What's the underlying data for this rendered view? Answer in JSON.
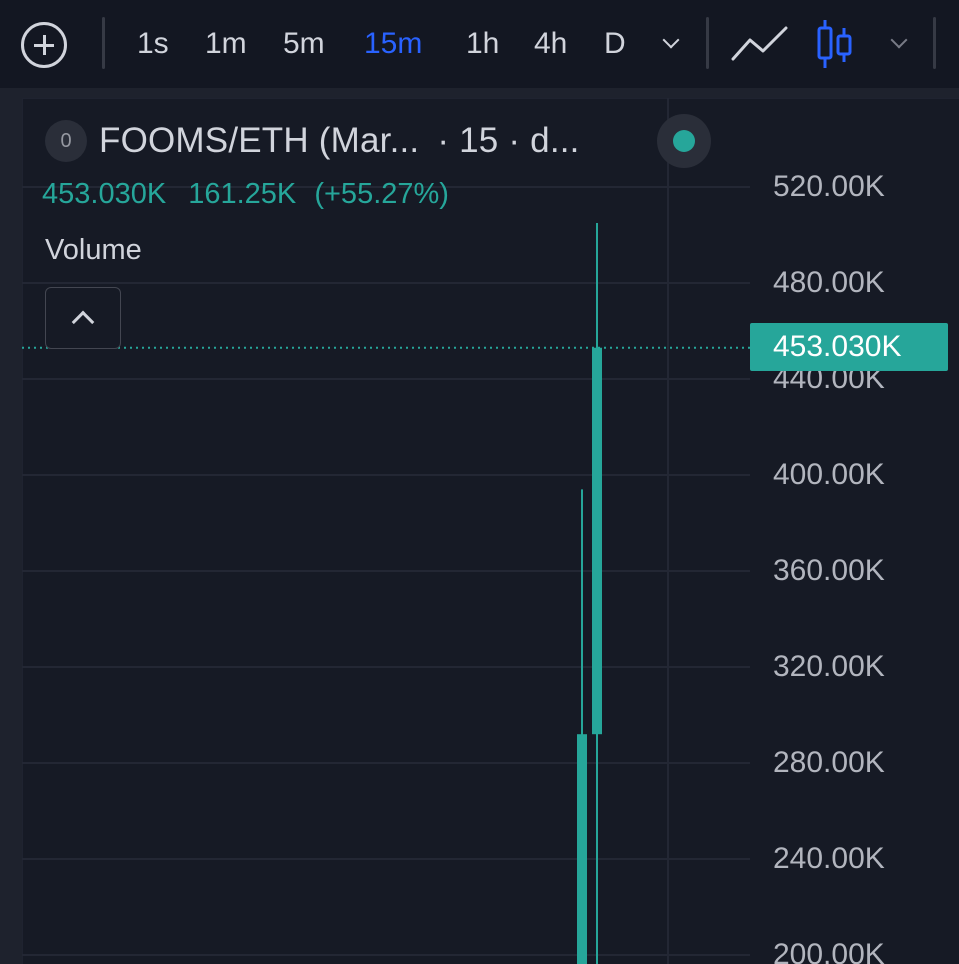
{
  "toolbar": {
    "intervals": [
      "1s",
      "1m",
      "5m",
      "15m",
      "1h",
      "4h",
      "D"
    ],
    "active_interval": "15m",
    "chart_style": "candles",
    "icons": [
      "plus-circle-icon",
      "chevron-down-icon",
      "line-chart-icon",
      "candlestick-icon",
      "chevron-down-icon"
    ]
  },
  "legend": {
    "source_badge": "0",
    "symbol": "FOOMS/ETH (Mar...",
    "interval_suffix": "· 15 · d...",
    "close": "453.030K",
    "change": "161.25K",
    "change_pct": "(+55.27%)",
    "indicator": "Volume",
    "status_color": "#26a69a"
  },
  "price_axis": {
    "labels": [
      "520.00K",
      "480.00K",
      "440.00K",
      "400.00K",
      "360.00K",
      "320.00K",
      "280.00K",
      "240.00K",
      "200.00K"
    ],
    "last_price": "453.030K"
  },
  "colors": {
    "up": "#26a69a",
    "background": "#161a25",
    "grid": "#232734",
    "accent": "#2962ff"
  },
  "chart_data": {
    "type": "candlestick",
    "y_unit": "K",
    "ylim": [
      188,
      534
    ],
    "candles": [
      {
        "open": 150,
        "high": 394,
        "low": 150,
        "close": 292
      },
      {
        "open": 292,
        "high": 505,
        "low": 150,
        "close": 453.03
      }
    ],
    "last_price": 453.03,
    "grid": true
  }
}
